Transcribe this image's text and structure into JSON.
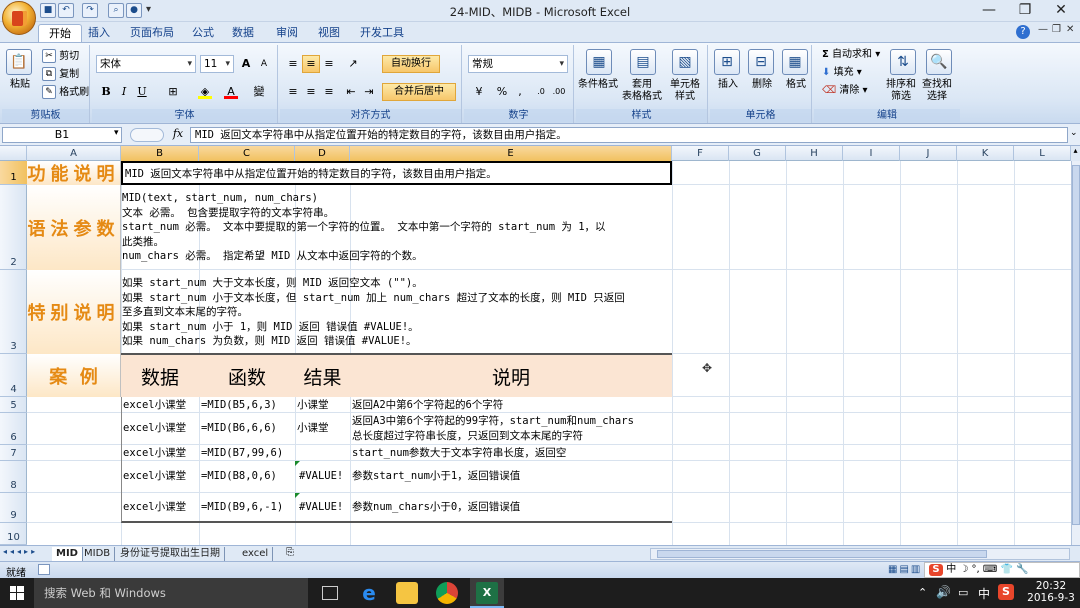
{
  "window": {
    "title": "24-MID、MIDB - Microsoft Excel",
    "controls": [
      "minimize-icon",
      "restore-icon",
      "close-icon"
    ]
  },
  "quick_access": [
    "save-icon",
    "undo-icon",
    "redo-icon",
    "find-icon",
    "camera-icon"
  ],
  "ribbon": {
    "tabs": [
      "开始",
      "插入",
      "页面布局",
      "公式",
      "数据",
      "审阅",
      "视图",
      "开发工具"
    ],
    "active_tab": "开始",
    "clipboard": {
      "label": "剪贴板",
      "paste": "粘贴",
      "cut": "剪切",
      "copy": "复制",
      "format_painter": "格式刷"
    },
    "font": {
      "label": "字体",
      "name": "宋体",
      "size": "11",
      "bold": "B",
      "italic": "I",
      "underline": "U",
      "grow": "A",
      "shrink": "A",
      "fill_color": "#ffff00",
      "font_color": "#ff0000"
    },
    "alignment": {
      "label": "对齐方式",
      "wrap": "自动换行",
      "merge": "合并后居中"
    },
    "number": {
      "label": "数字",
      "format": "常规",
      "percent": "%",
      "comma": ","
    },
    "styles": {
      "label": "样式",
      "conditional": "条件格式",
      "table": "套用\n表格格式",
      "cell_styles": "单元格\n样式"
    },
    "cells": {
      "label": "单元格",
      "insert": "插入",
      "delete": "删除",
      "format": "格式"
    },
    "editing": {
      "label": "编辑",
      "autosum": "自动求和",
      "fill": "填充",
      "clear": "清除",
      "sort": "排序和\n筛选",
      "find": "查找和\n选择"
    }
  },
  "formula_bar": {
    "name_box": "B1",
    "fx": "fx",
    "content": "MID 返回文本字符串中从指定位置开始的特定数目的字符，该数目由用户指定。"
  },
  "columns": [
    "A",
    "B",
    "C",
    "D",
    "E",
    "F",
    "G",
    "H",
    "I",
    "J",
    "K",
    "L"
  ],
  "rows": [
    "1",
    "2",
    "3",
    "4",
    "5",
    "6",
    "7",
    "8",
    "9",
    "10"
  ],
  "sheet": {
    "r1": {
      "label": "功能说明",
      "text": "MID 返回文本字符串中从指定位置开始的特定数目的字符，该数目由用户指定。"
    },
    "r2": {
      "label": "语法参数",
      "lines": [
        "MID(text, start_num, num_chars)",
        "文本    必需。 包含要提取字符的文本字符串。",
        "start_num    必需。 文本中要提取的第一个字符的位置。 文本中第一个字符的 start_num 为 1，以",
        "此类推。",
        "num_chars    必需。 指定希望 MID 从文本中返回字符的个数。"
      ]
    },
    "r3": {
      "label": "特别说明",
      "lines": [
        "如果 start_num 大于文本长度，则 MID 返回空文本 (\"\")。",
        "如果 start_num 小于文本长度，但 start_num 加上 num_chars 超过了文本的长度，则 MID 只返回",
        "至多直到文本末尾的字符。",
        "如果 start_num 小于 1，则 MID 返回 错误值 #VALUE!。",
        "如果 num_chars 为负数，则 MID 返回 错误值 #VALUE!。"
      ]
    },
    "r4": {
      "label": "案  例",
      "h_data": "数据",
      "h_func": "函数",
      "h_result": "结果",
      "h_desc": "说明"
    },
    "examples": [
      {
        "data": "excel小课堂",
        "func": "=MID(B5,6,3)",
        "result": "小课堂",
        "desc": [
          "返回A2中第6个字符起的6个字符"
        ]
      },
      {
        "data": "excel小课堂",
        "func": "=MID(B6,6,6)",
        "result": "小课堂",
        "desc": [
          "返回A3中第6个字符起的99字符，start_num和num_chars",
          "总长度超过字符串长度，只返回到文本末尾的字符"
        ]
      },
      {
        "data": "excel小课堂",
        "func": "=MID(B7,99,6)",
        "result": "",
        "desc": [
          "start_num参数大于文本字符串长度，返回空"
        ]
      },
      {
        "data": "excel小课堂",
        "func": "=MID(B8,0,6)",
        "result": "#VALUE!",
        "desc": [
          "参数start_num小于1，返回错误值"
        ]
      },
      {
        "data": "excel小课堂",
        "func": "=MID(B9,6,-1)",
        "result": "#VALUE!",
        "desc": [
          "参数num_chars小于0，返回错误值"
        ]
      }
    ]
  },
  "sheet_tabs": [
    "MID",
    "MIDB",
    "身份证号提取出生日期",
    "excel"
  ],
  "active_sheet": "MID",
  "status": {
    "ready": "就绪"
  },
  "taskbar": {
    "search": "搜索 Web 和 Windows",
    "ime": "中",
    "lang": "中",
    "time": "20:32",
    "date": "2016-9-3"
  },
  "accent": {
    "label_orange": "#e58a14",
    "case_fill": "#fbe5d3",
    "selection": "#f1c15f"
  }
}
